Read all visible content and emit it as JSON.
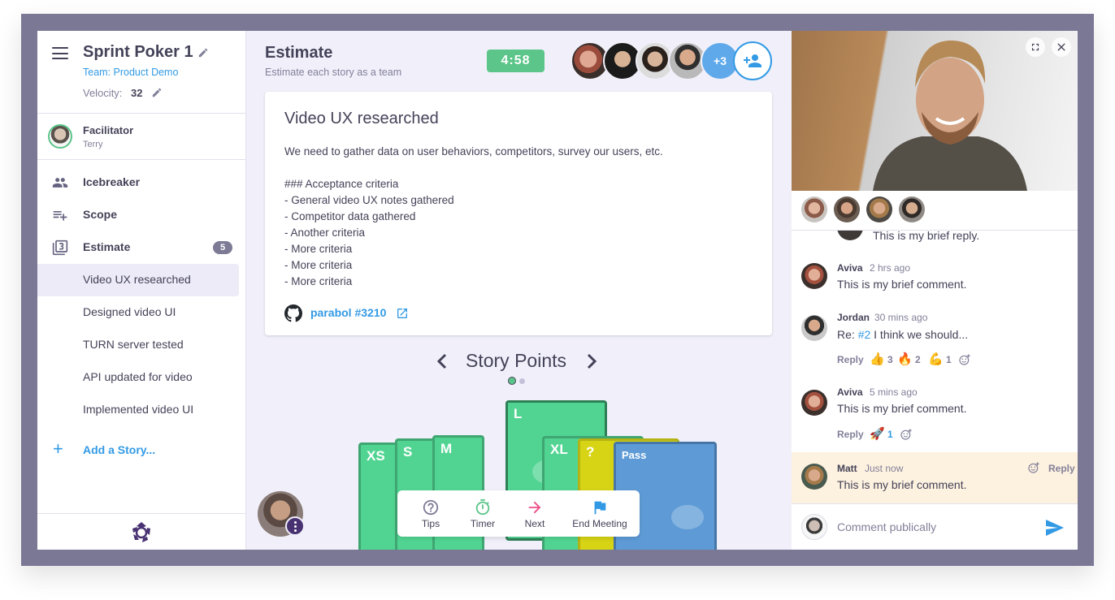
{
  "sidebar": {
    "meeting_title": "Sprint Poker 1",
    "team": "Team: Product Demo",
    "velocity_label": "Velocity:",
    "velocity_value": "32",
    "facilitator_label": "Facilitator",
    "facilitator_name": "Terry",
    "nav": [
      {
        "label": "Icebreaker",
        "icon": "group-icon"
      },
      {
        "label": "Scope",
        "icon": "playlist-add-icon"
      },
      {
        "label": "Estimate",
        "icon": "filter-3-icon",
        "badge": "5"
      }
    ],
    "stories": [
      {
        "label": "Video UX researched",
        "active": true
      },
      {
        "label": "Designed video UI"
      },
      {
        "label": "TURN server tested"
      },
      {
        "label": "API updated for video"
      },
      {
        "label": "Implemented video UI"
      }
    ],
    "add_story_label": "Add a Story..."
  },
  "header": {
    "phase_title": "Estimate",
    "phase_description": "Estimate each story as a team",
    "timer": "4:58",
    "overflow_count": "+3"
  },
  "story": {
    "title": "Video UX researched",
    "body": "We need to gather data on user behaviors, competitors, survey our users, etc.\n\n### Acceptance criteria\n- General video UX notes gathered\n- Competitor data gathered\n- Another criteria\n- More criteria\n- More criteria\n- More criteria",
    "link_label": "parabol #3210"
  },
  "dimension": {
    "label": "Story Points",
    "page": 1,
    "pages": 2
  },
  "cards": [
    {
      "label": "XS",
      "color": "#51d492"
    },
    {
      "label": "S",
      "color": "#51d492"
    },
    {
      "label": "M",
      "color": "#51d492"
    },
    {
      "label": "L",
      "color": "#51d492",
      "selected": true
    },
    {
      "label": "XL",
      "color": "#51d492"
    },
    {
      "label": "?",
      "color": "#d7d416"
    },
    {
      "label": "Pass",
      "color": "#5e9bd6"
    }
  ],
  "toolbar": {
    "tips": "Tips",
    "timer": "Timer",
    "next": "Next",
    "end": "End Meeting"
  },
  "comments": [
    {
      "text": "This is my brief reply."
    },
    {
      "author": "Aviva",
      "time": "2 hrs ago",
      "text": "This is my brief comment."
    },
    {
      "author": "Jordan",
      "time": "30 mins ago",
      "text_prefix": "Re:",
      "ref": "#2",
      "text": "I think we should...",
      "reply": "Reply",
      "reactions": [
        {
          "emoji": "👍",
          "count": "3"
        },
        {
          "emoji": "🔥",
          "count": "2"
        },
        {
          "emoji": "💪",
          "count": "1"
        }
      ]
    },
    {
      "author": "Aviva",
      "time": "5 mins ago",
      "text": "This is my brief comment.",
      "reply": "Reply",
      "reactions": [
        {
          "emoji": "🚀",
          "count": "1",
          "mine": true
        }
      ]
    },
    {
      "author": "Matt",
      "time": "Just now",
      "text": "This is my brief comment.",
      "reply": "Reply"
    }
  ],
  "composer": {
    "placeholder": "Comment publically"
  },
  "colors": {
    "accent": "#329ae5",
    "success": "#5cc58a",
    "brand": "#493272",
    "highlight": "#fdf1df"
  }
}
